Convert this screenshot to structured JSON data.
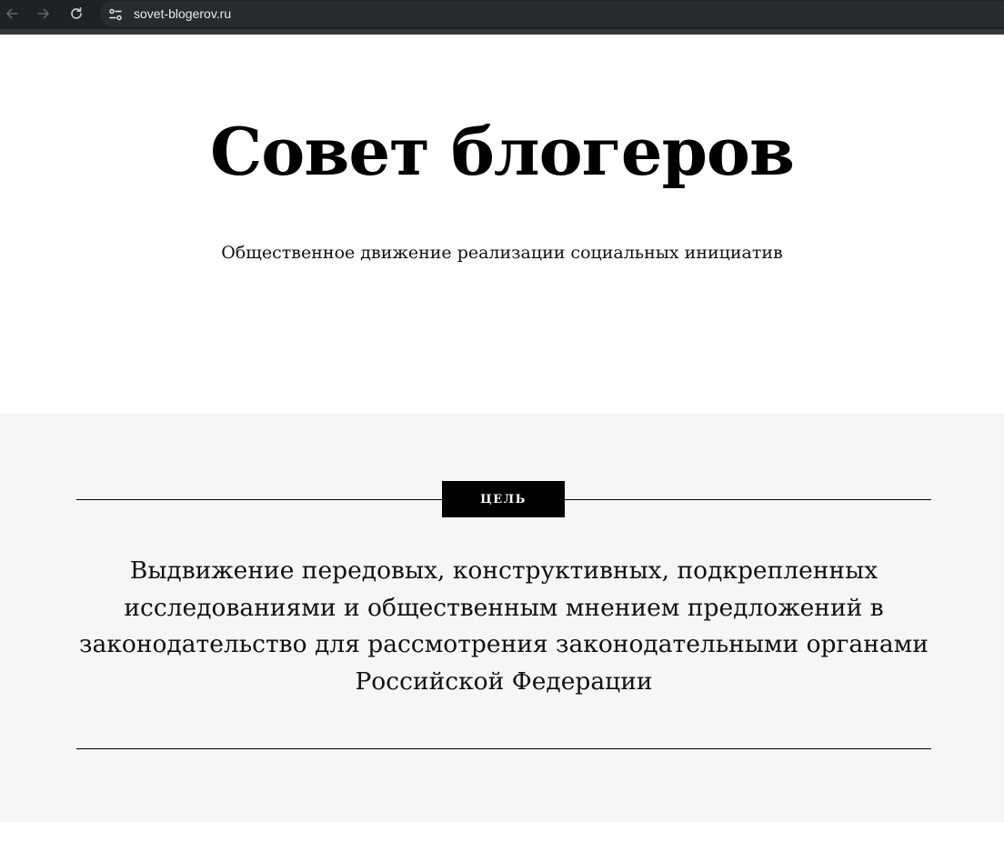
{
  "browser": {
    "url": "sovet-blogerov.ru",
    "icons": {
      "back": "arrow-left-icon",
      "forward": "arrow-right-icon",
      "reload": "reload-icon",
      "site_info": "tune-icon"
    }
  },
  "header": {
    "title": "Совет блогеров",
    "subtitle": "Общественное движение реализации социальных инициатив"
  },
  "goal": {
    "badge_label": "ЦЕЛЬ",
    "text": "Выдвижение передовых, конструктивных, подкрепленных исследованиями и общественным мнением предложений в законодательство для рассмотрения законодательными органами Российской Федерации"
  },
  "colors": {
    "toolbar": "#202124",
    "omnibox": "#282a2d",
    "section_background": "#f6f6f6",
    "badge": "#000000",
    "text": "#000000"
  }
}
